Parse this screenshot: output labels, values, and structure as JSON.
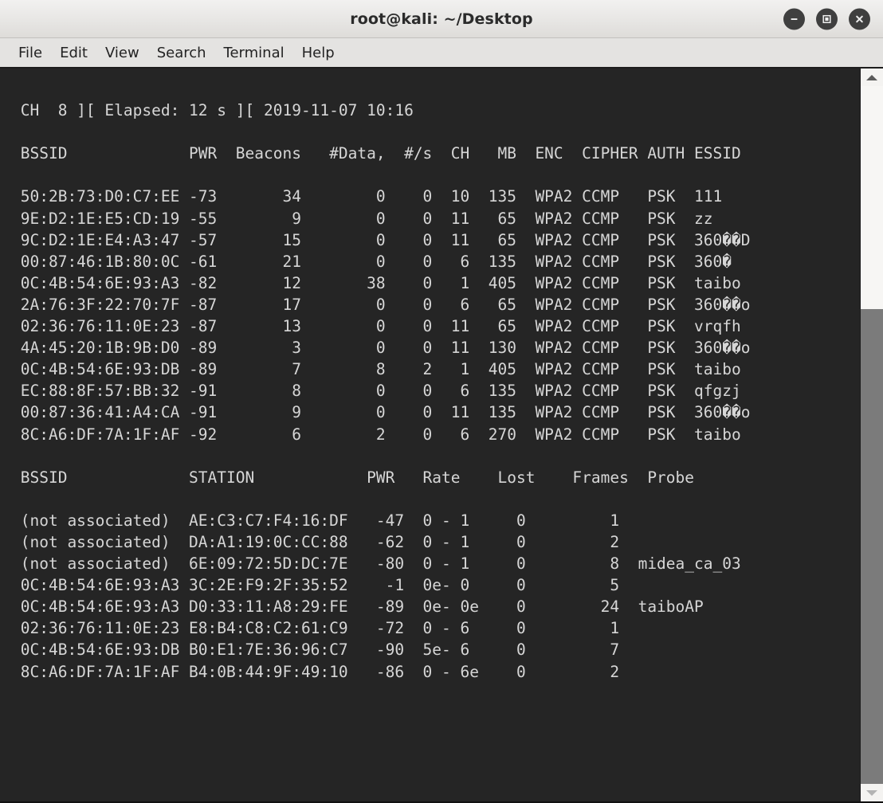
{
  "window": {
    "title": "root@kali: ~/Desktop",
    "buttons": [
      {
        "name": "minimize",
        "glyph": "minus"
      },
      {
        "name": "maximize",
        "glyph": "square"
      },
      {
        "name": "close",
        "glyph": "cross"
      }
    ]
  },
  "menubar": {
    "items": [
      "File",
      "Edit",
      "View",
      "Search",
      "Terminal",
      "Help"
    ]
  },
  "terminal": {
    "status_line": " CH  8 ][ Elapsed: 12 s ][ 2019-11-07 10:16",
    "ap_header": " BSSID              PWR  Beacons    #Data, #/s  CH  MB   ENC  CIPHER AUTH ESSID",
    "station_header": " BSSID              STATION            PWR   Rate    Lost    Frames  Probe",
    "ap_table": {
      "columns": [
        "BSSID",
        "PWR",
        "Beacons",
        "#Data,",
        "#/s",
        "CH",
        "MB",
        "ENC",
        "CIPHER",
        "AUTH",
        "ESSID"
      ],
      "rows": [
        {
          "bssid": "50:2B:73:D0:C7:EE",
          "pwr": "-73",
          "beacons": "34",
          "data": "0",
          "ps": "0",
          "ch": "10",
          "mb": "135",
          "enc": "WPA2",
          "cipher": "CCMP",
          "auth": "PSK",
          "essid": "111"
        },
        {
          "bssid": "9E:D2:1E:E5:CD:19",
          "pwr": "-55",
          "beacons": "9",
          "data": "0",
          "ps": "0",
          "ch": "11",
          "mb": "65",
          "enc": "WPA2",
          "cipher": "CCMP",
          "auth": "PSK",
          "essid": "zz"
        },
        {
          "bssid": "9C:D2:1E:E4:A3:47",
          "pwr": "-57",
          "beacons": "15",
          "data": "0",
          "ps": "0",
          "ch": "11",
          "mb": "65",
          "enc": "WPA2",
          "cipher": "CCMP",
          "auth": "PSK",
          "essid": "360��D"
        },
        {
          "bssid": "00:87:46:1B:80:0C",
          "pwr": "-61",
          "beacons": "21",
          "data": "0",
          "ps": "0",
          "ch": "6",
          "mb": "135",
          "enc": "WPA2",
          "cipher": "CCMP",
          "auth": "PSK",
          "essid": "360�"
        },
        {
          "bssid": "0C:4B:54:6E:93:A3",
          "pwr": "-82",
          "beacons": "12",
          "data": "38",
          "ps": "0",
          "ch": "1",
          "mb": "405",
          "enc": "WPA2",
          "cipher": "CCMP",
          "auth": "PSK",
          "essid": "taibo"
        },
        {
          "bssid": "2A:76:3F:22:70:7F",
          "pwr": "-87",
          "beacons": "17",
          "data": "0",
          "ps": "0",
          "ch": "6",
          "mb": "65",
          "enc": "WPA2",
          "cipher": "CCMP",
          "auth": "PSK",
          "essid": "360��o"
        },
        {
          "bssid": "02:36:76:11:0E:23",
          "pwr": "-87",
          "beacons": "13",
          "data": "0",
          "ps": "0",
          "ch": "11",
          "mb": "65",
          "enc": "WPA2",
          "cipher": "CCMP",
          "auth": "PSK",
          "essid": "vrqfh"
        },
        {
          "bssid": "4A:45:20:1B:9B:D0",
          "pwr": "-89",
          "beacons": "3",
          "data": "0",
          "ps": "0",
          "ch": "11",
          "mb": "130",
          "enc": "WPA2",
          "cipher": "CCMP",
          "auth": "PSK",
          "essid": "360��o"
        },
        {
          "bssid": "0C:4B:54:6E:93:DB",
          "pwr": "-89",
          "beacons": "7",
          "data": "8",
          "ps": "2",
          "ch": "1",
          "mb": "405",
          "enc": "WPA2",
          "cipher": "CCMP",
          "auth": "PSK",
          "essid": "taibo"
        },
        {
          "bssid": "EC:88:8F:57:BB:32",
          "pwr": "-91",
          "beacons": "8",
          "data": "0",
          "ps": "0",
          "ch": "6",
          "mb": "135",
          "enc": "WPA2",
          "cipher": "CCMP",
          "auth": "PSK",
          "essid": "qfgzj"
        },
        {
          "bssid": "00:87:36:41:A4:CA",
          "pwr": "-91",
          "beacons": "9",
          "data": "0",
          "ps": "0",
          "ch": "11",
          "mb": "135",
          "enc": "WPA2",
          "cipher": "CCMP",
          "auth": "PSK",
          "essid": "360��o"
        },
        {
          "bssid": "8C:A6:DF:7A:1F:AF",
          "pwr": "-92",
          "beacons": "6",
          "data": "2",
          "ps": "0",
          "ch": "6",
          "mb": "270",
          "enc": "WPA2",
          "cipher": "CCMP",
          "auth": "PSK",
          "essid": "taibo"
        }
      ]
    },
    "station_table": {
      "columns": [
        "BSSID",
        "STATION",
        "PWR",
        "Rate",
        "Lost",
        "Frames",
        "Probe"
      ],
      "rows": [
        {
          "bssid": "(not associated)",
          "station": "AE:C3:C7:F4:16:DF",
          "pwr": "-47",
          "rate": "0 - 1",
          "lost": "0",
          "frames": "1",
          "probe": ""
        },
        {
          "bssid": "(not associated)",
          "station": "DA:A1:19:0C:CC:88",
          "pwr": "-62",
          "rate": "0 - 1",
          "lost": "0",
          "frames": "2",
          "probe": ""
        },
        {
          "bssid": "(not associated)",
          "station": "6E:09:72:5D:DC:7E",
          "pwr": "-80",
          "rate": "0 - 1",
          "lost": "0",
          "frames": "8",
          "probe": "midea_ca_03"
        },
        {
          "bssid": "0C:4B:54:6E:93:A3",
          "station": "3C:2E:F9:2F:35:52",
          "pwr": "-1",
          "rate": "0e- 0",
          "lost": "0",
          "frames": "5",
          "probe": ""
        },
        {
          "bssid": "0C:4B:54:6E:93:A3",
          "station": "D0:33:11:A8:29:FE",
          "pwr": "-89",
          "rate": "0e- 0e",
          "lost": "0",
          "frames": "24",
          "probe": "taiboAP"
        },
        {
          "bssid": "02:36:76:11:0E:23",
          "station": "E8:B4:C8:C2:61:C9",
          "pwr": "-72",
          "rate": "0 - 6",
          "lost": "0",
          "frames": "1",
          "probe": ""
        },
        {
          "bssid": "0C:4B:54:6E:93:DB",
          "station": "B0:E1:7E:36:96:C7",
          "pwr": "-90",
          "rate": "5e- 6",
          "lost": "0",
          "frames": "7",
          "probe": ""
        },
        {
          "bssid": "8C:A6:DF:7A:1F:AF",
          "station": "B4:0B:44:9F:49:10",
          "pwr": "-86",
          "rate": "0 - 6e",
          "lost": "0",
          "frames": "2",
          "probe": ""
        }
      ]
    }
  },
  "colors": {
    "terminal_bg": "#252525",
    "terminal_fg": "#d6d6d6",
    "titlebar_bg": "#e7e6e4",
    "menubar_bg": "#e4e3e1",
    "scrollbar_thumb": "#7b7b7b"
  }
}
